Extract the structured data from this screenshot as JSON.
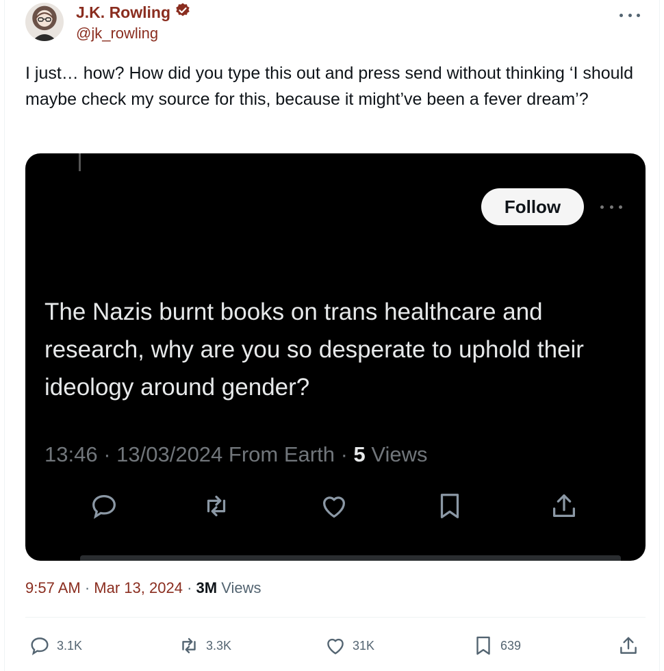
{
  "author": {
    "name": "J.K. Rowling",
    "handle": "@jk_rowling",
    "verified_color": "#8a2d1f"
  },
  "tweet": {
    "text": "I just… how? How did you type this out and press send without thinking ‘I should maybe check my source for this, because it might’ve been a fever dream’?"
  },
  "screenshot": {
    "follow_label": "Follow",
    "quote_text": "The Nazis burnt books on trans healthcare and research, why are you so desperate to uphold their ideology around gender?",
    "time": "13:46",
    "date": "13/03/2024",
    "source": "From Earth",
    "views_count": "5",
    "views_label": "Views"
  },
  "meta": {
    "time": "9:57 AM",
    "date": "Mar 13, 2024",
    "views_count": "3M",
    "views_label": "Views"
  },
  "actions": {
    "replies": "3.1K",
    "reposts": "3.3K",
    "likes": "31K",
    "bookmarks": "639"
  },
  "icons": [
    "verified-badge-icon",
    "more-icon",
    "reply-icon",
    "repost-icon",
    "like-icon",
    "bookmark-icon",
    "share-icon"
  ],
  "colors": {
    "accent": "#8a2d1f",
    "muted": "#536471",
    "media_bg": "#000000"
  }
}
